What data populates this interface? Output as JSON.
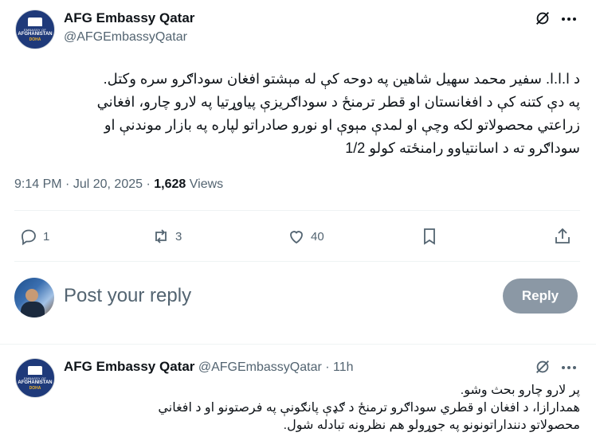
{
  "post": {
    "author_name": "AFG Embassy Qatar",
    "author_handle": "@AFGEmbassyQatar",
    "avatar": {
      "line1": "EMBASSY OF",
      "line2": "AFGHANISTAN",
      "line3": "DOHA"
    },
    "text_lines": [
      "د ا.ا.ا. سفیر محمد سهیل شاهین په دوحه کې له مېشتو افغان سوداګرو سره وکتل.",
      "په دې کتنه کې د افغانستان او قطر ترمنځ د سوداګریزې پیاوړتیا په لارو چارو، افغاني",
      "زراعتي محصولاتو  لکه وچې او لمدې مېوې او نورو صادراتو لپاره په بازار موندنې او",
      "سوداګرو ته د اسانتیاوو رامنځته کولو 1/2"
    ],
    "time": "9:14 PM",
    "date": "Jul 20, 2025",
    "views_count": "1,628",
    "views_label": "Views",
    "separator": "·",
    "actions": {
      "replies": "1",
      "reposts": "3",
      "likes": "40"
    }
  },
  "compose": {
    "placeholder": "Post your reply",
    "reply_button": "Reply"
  },
  "reply": {
    "author_name": "AFG Embassy Qatar",
    "author_handle": "@AFGEmbassyQatar",
    "time_ago": "11h",
    "separator": "·",
    "text_lines": [
      "پر لارو چارو بحث وشو.",
      "همدارازا، د افغان او قطري سوداګرو ترمنځ د ګډې پانګونې په فرصتونو او د افغاني",
      "محصولاتو دننداراتونونو په جوړولو هم نظرونه تبادله شول."
    ]
  },
  "icons": {
    "grok": "grok-icon",
    "more": "more-icon",
    "reply": "reply-icon",
    "repost": "repost-icon",
    "like": "heart-icon",
    "bookmark": "bookmark-icon",
    "share": "share-icon"
  },
  "colors": {
    "text": "#0f1419",
    "secondary": "#536471",
    "reply_button_disabled": "#8b98a5"
  }
}
